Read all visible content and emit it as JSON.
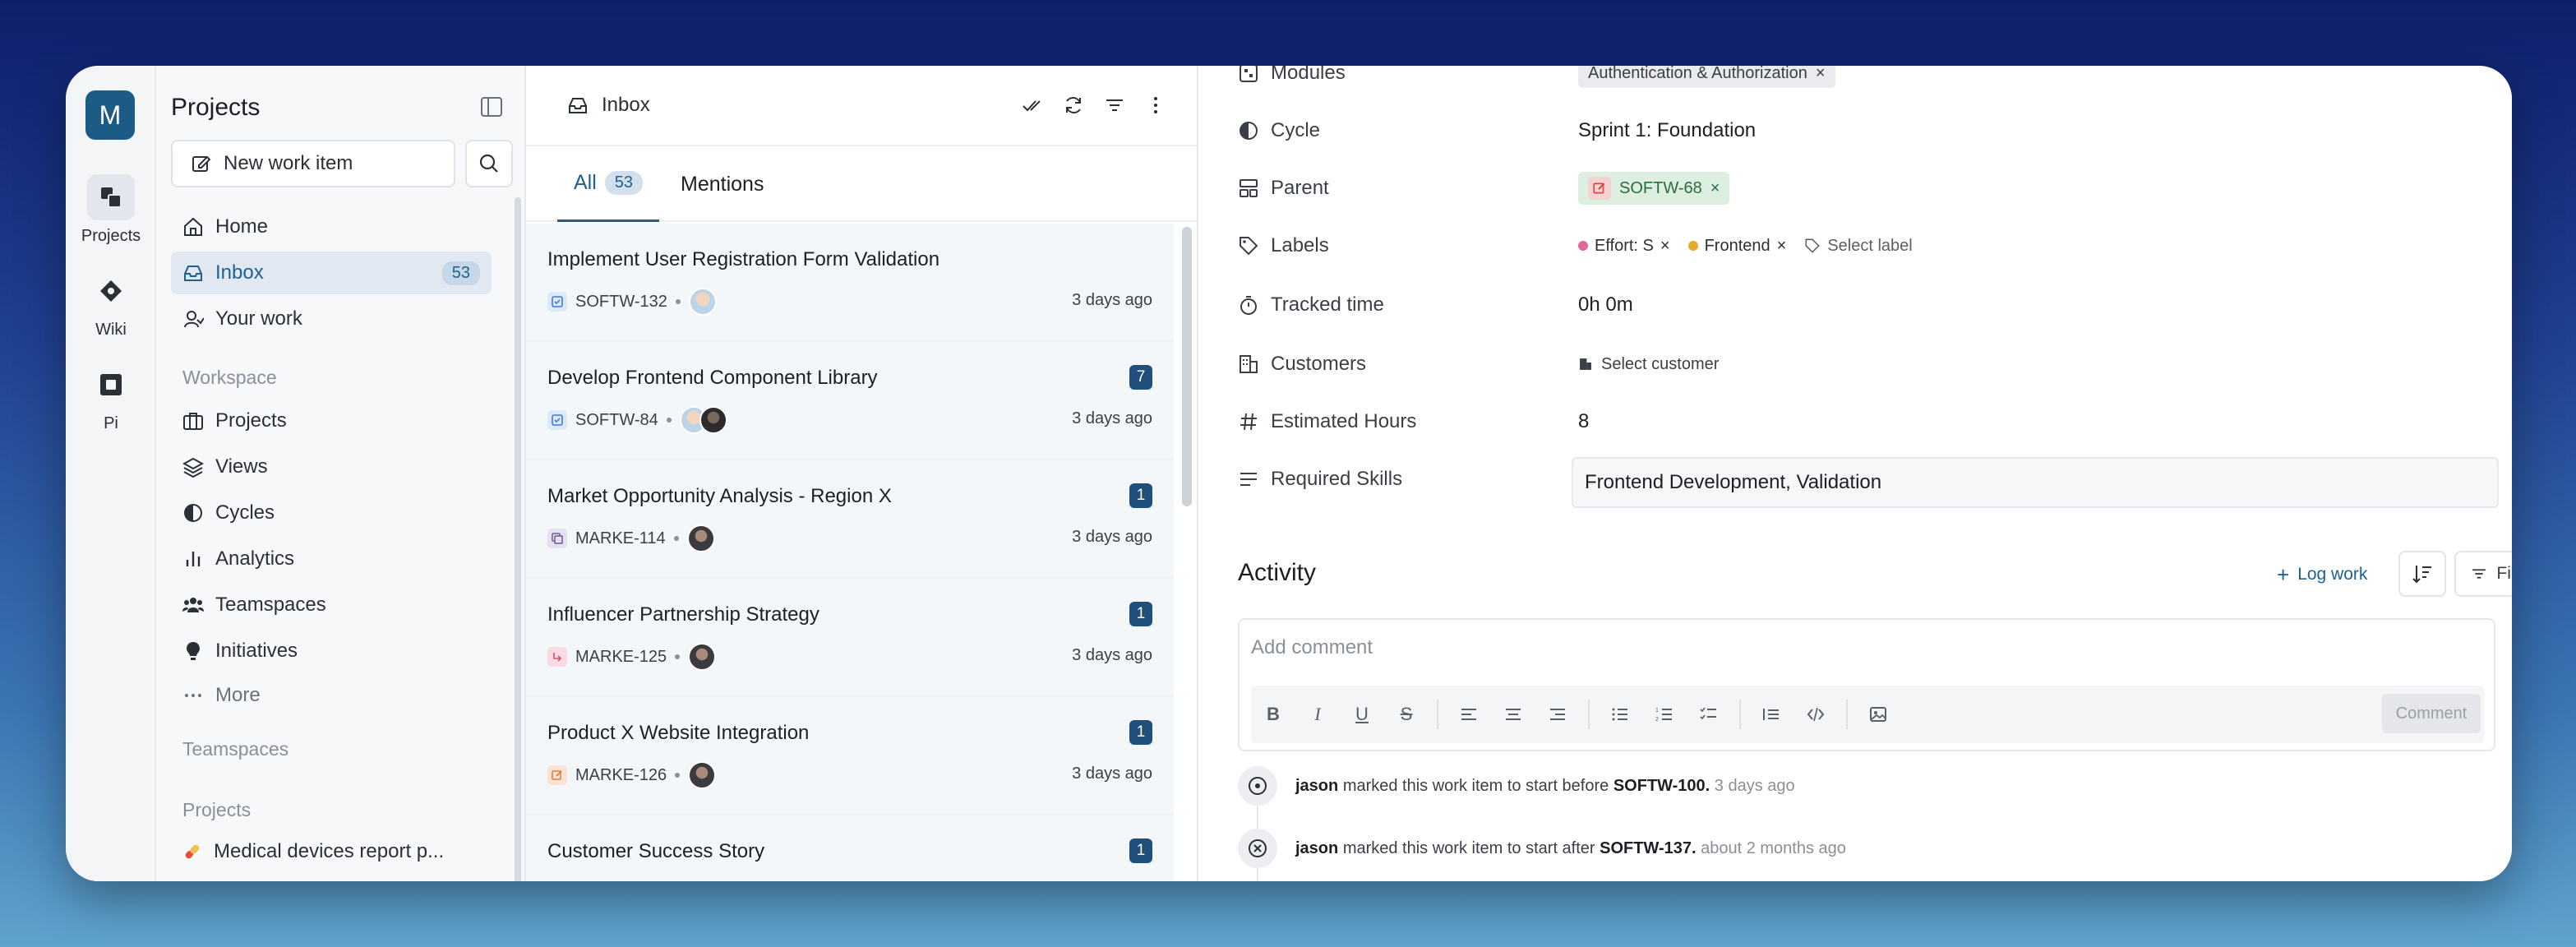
{
  "rail": {
    "avatar_letter": "M",
    "items": [
      {
        "label": "Projects",
        "icon": "projects-icon"
      },
      {
        "label": "Wiki",
        "icon": "wiki-icon"
      },
      {
        "label": "Pi",
        "icon": "pi-icon"
      }
    ]
  },
  "sidebar": {
    "title": "Projects",
    "new_work_item": "New work item",
    "nav": [
      {
        "label": "Home"
      },
      {
        "label": "Inbox",
        "count": "53"
      },
      {
        "label": "Your work"
      }
    ],
    "workspace_label": "Workspace",
    "workspace": [
      {
        "label": "Projects"
      },
      {
        "label": "Views"
      },
      {
        "label": "Cycles"
      },
      {
        "label": "Analytics"
      },
      {
        "label": "Teamspaces"
      },
      {
        "label": "Initiatives"
      },
      {
        "label": "More"
      }
    ],
    "teamspaces_label": "Teamspaces",
    "projects_label": "Projects",
    "project_item": "Medical devices report p..."
  },
  "inbox": {
    "title": "Inbox",
    "tabs": [
      {
        "label": "All",
        "count": "53"
      },
      {
        "label": "Mentions"
      }
    ],
    "items": [
      {
        "title": "Implement User Registration Form Validation",
        "id": "SOFTW-132",
        "time": "3 days ago",
        "badge": ""
      },
      {
        "title": "Develop Frontend Component Library",
        "id": "SOFTW-84",
        "time": "3 days ago",
        "badge": "7"
      },
      {
        "title": "Market Opportunity Analysis - Region X",
        "id": "MARKE-114",
        "time": "3 days ago",
        "badge": "1"
      },
      {
        "title": "Influencer Partnership Strategy",
        "id": "MARKE-125",
        "time": "3 days ago",
        "badge": "1"
      },
      {
        "title": "Product X Website Integration",
        "id": "MARKE-126",
        "time": "3 days ago",
        "badge": "1"
      },
      {
        "title": "Customer Success Story",
        "id": "",
        "time": "",
        "badge": "1"
      }
    ]
  },
  "detail": {
    "props": {
      "modules": {
        "label": "Modules",
        "value": "Authentication & Authorization"
      },
      "cycle": {
        "label": "Cycle",
        "value": "Sprint 1: Foundation"
      },
      "parent": {
        "label": "Parent",
        "value": "SOFTW-68"
      },
      "labels": {
        "label": "Labels",
        "label1": "Effort: S",
        "label2": "Frontend",
        "select": "Select label"
      },
      "tracked": {
        "label": "Tracked time",
        "value": "0h 0m"
      },
      "customers": {
        "label": "Customers",
        "value": "Select customer"
      },
      "hours": {
        "label": "Estimated Hours",
        "value": "8"
      },
      "skills": {
        "label": "Required Skills",
        "value": "Frontend Development, Validation"
      }
    },
    "activity": {
      "title": "Activity",
      "log_work": "Log work",
      "filters": "Filters",
      "comment_placeholder": "Add comment",
      "comment_button": "Comment",
      "entries": [
        {
          "user": "jason",
          "text": "marked this work item to start before",
          "ref": "SOFTW-100.",
          "time": "3 days ago"
        },
        {
          "user": "jason",
          "text": "marked this work item to start after",
          "ref": "SOFTW-137.",
          "time": "about 2 months ago"
        }
      ]
    }
  },
  "colors": {
    "accent": "#1f5f91",
    "badge": "#1f4f7a",
    "effort": "#e0689a",
    "frontend": "#e7a92c"
  }
}
